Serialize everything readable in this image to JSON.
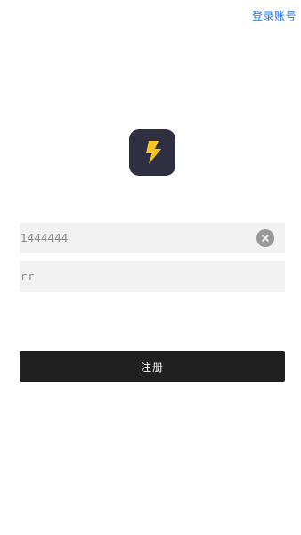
{
  "header": {
    "login_link": "登录账号"
  },
  "logo": {
    "icon": "lightning-bolt-icon",
    "background_color": "#2e3042",
    "bolt_color": "#f7c51e"
  },
  "form": {
    "phone": {
      "value": "1444444",
      "clear_icon": "clear-circle-x-icon"
    },
    "code": {
      "value": "rr"
    },
    "submit_label": "注册"
  },
  "colors": {
    "link": "#1a73e8",
    "button_bg": "#202020",
    "field_bg": "#f2f2f2"
  }
}
